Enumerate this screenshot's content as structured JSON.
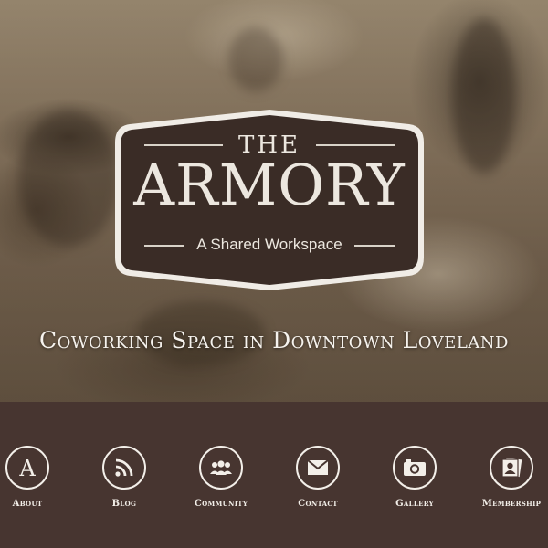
{
  "logo": {
    "the": "THE",
    "name": "ARMORY",
    "tagline": "A Shared Workspace"
  },
  "headline": "Coworking Space in Downtown Loveland",
  "nav": {
    "items": [
      {
        "label": "About",
        "icon": "letter-a-icon"
      },
      {
        "label": "Blog",
        "icon": "rss-icon"
      },
      {
        "label": "Community",
        "icon": "people-icon"
      },
      {
        "label": "Contact",
        "icon": "envelope-icon"
      },
      {
        "label": "Gallery",
        "icon": "camera-icon"
      },
      {
        "label": "Membership",
        "icon": "id-card-icon"
      }
    ]
  },
  "colors": {
    "nav_background": "#473530",
    "badge_background": "#3a2c26",
    "text_light": "#f3efe9"
  }
}
